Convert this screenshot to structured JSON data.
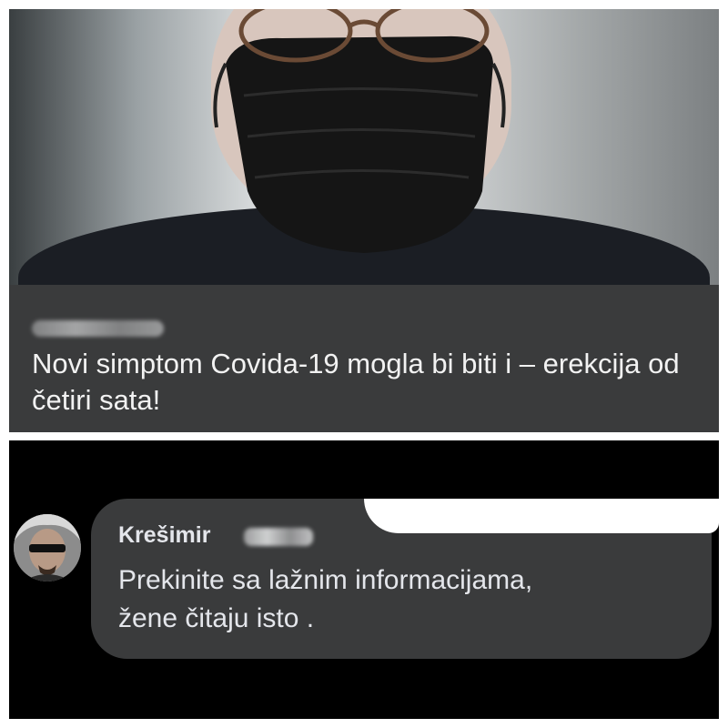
{
  "post": {
    "headline": "Novi simptom Covida-19 mogla bi biti i – erekcija od četiri sata!"
  },
  "comment": {
    "author": "Krešimir",
    "text_line1": "Prekinite sa lažnim informacijama,",
    "text_line2": "žene čitaju isto ."
  },
  "icons": {
    "avatar": "avatar-photo",
    "preview_image": "person-wearing-black-face-mask-photo"
  },
  "colors": {
    "card_background": "#3a3b3c",
    "text_primary": "#f2f2f2",
    "band_black": "#000000"
  }
}
